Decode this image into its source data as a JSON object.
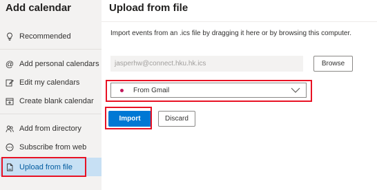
{
  "sidebar": {
    "title": "Add calendar",
    "items": [
      {
        "label": "Recommended",
        "icon": "lightbulb-icon"
      },
      {
        "label": "Add personal calendars",
        "icon": "at-icon"
      },
      {
        "label": "Edit my calendars",
        "icon": "edit-icon"
      },
      {
        "label": "Create blank calendar",
        "icon": "calendar-add-icon"
      },
      {
        "label": "Add from directory",
        "icon": "people-icon"
      },
      {
        "label": "Subscribe from web",
        "icon": "globe-icon"
      },
      {
        "label": "Upload from file",
        "icon": "file-icon"
      }
    ]
  },
  "main": {
    "title": "Upload from file",
    "description": "Import events from an .ics file by dragging it here or by browsing this computer.",
    "file_value": "jasperhw@connect.hku.hk.ics",
    "browse_label": "Browse",
    "calendar_select": {
      "selected": "From Gmail",
      "dot_color": "#c2185b"
    },
    "import_label": "Import",
    "discard_label": "Discard"
  },
  "colors": {
    "accent": "#0078d4",
    "active_nav": "#c7e0f4",
    "highlight_box": "#e81123"
  }
}
